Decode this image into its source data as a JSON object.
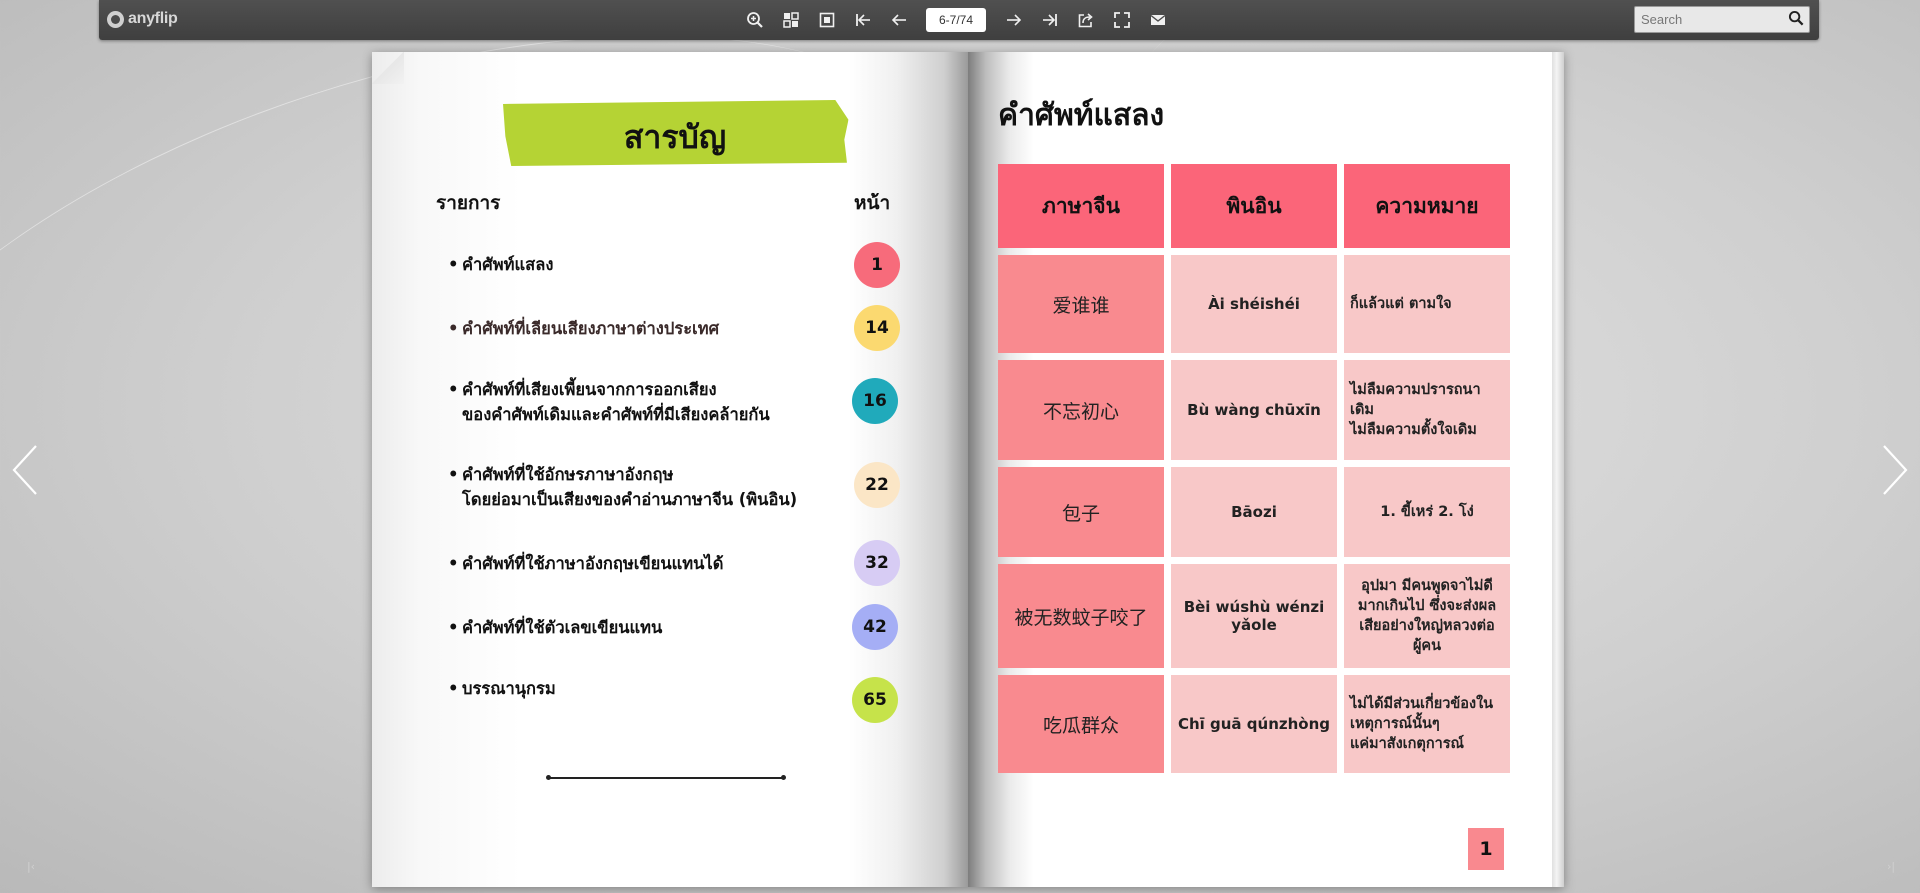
{
  "toolbar": {
    "logo_text": "anyflip",
    "page_indicator": "6-7/74",
    "search_placeholder": "Search",
    "icons": [
      "zoom-in-icon",
      "thumbnails-icon",
      "single-page-icon",
      "first-page-icon",
      "previous-page-icon",
      "next-page-icon",
      "last-page-icon",
      "share-icon",
      "fullscreen-icon",
      "email-icon",
      "search-icon"
    ]
  },
  "left_page": {
    "title": "สารบัญ",
    "header_items": "รายการ",
    "header_page": "หน้า",
    "highlight_color": "#b5d334",
    "items": [
      {
        "lines": [
          "คำศัพท์แสลง"
        ],
        "page": "1",
        "color": "#f76b7b"
      },
      {
        "lines": [
          "คำศัพท์ที่เลียนเสียงภาษาต่างประเทศ"
        ],
        "page": "14",
        "color": "#fbd970"
      },
      {
        "lines": [
          "คำศัพท์ที่เสียงเพี้ยนจากการออกเสียง",
          "ของคำศัพท์เดิมและคำศัพท์ที่มีเสียงคล้ายกัน"
        ],
        "page": "16",
        "color": "#20aabb"
      },
      {
        "lines": [
          "คำศัพท์ที่ใช้อักษรภาษาอังกฤษ",
          "โดยย่อมาเป็นเสียงของคำอ่านภาษาจีน (พินอิน)"
        ],
        "page": "22",
        "color": "#fbe6c6"
      },
      {
        "lines": [
          "คำศัพท์ที่ใช้ภาษาอังกฤษเขียนแทนได้"
        ],
        "page": "32",
        "color": "#d7ccf4"
      },
      {
        "lines": [
          "คำศัพท์ที่ใช้ตัวเลขเขียนแทน"
        ],
        "page": "42",
        "color": "#a5aef5"
      },
      {
        "lines": [
          "บรรณานุกรม"
        ],
        "page": "65",
        "color": "#c6e34a"
      }
    ]
  },
  "right_page": {
    "title": "คำศัพท์แสลง",
    "headers": [
      "ภาษาจีน",
      "พินอิน",
      "ความหมาย"
    ],
    "rows": [
      {
        "chinese": "爱谁谁",
        "pinyin": "Ài shéishéi",
        "meaning": "ก็แล้วแต่ ตามใจ"
      },
      {
        "chinese": "不忘初心",
        "pinyin": "Bù wàng chūxīn",
        "meaning": "ไม่ลืมความปรารถนา\nเดิม\nไม่ลืมความตั้งใจเดิม"
      },
      {
        "chinese": "包子",
        "pinyin": "Bāozi",
        "meaning": "1. ขี้เหร่ 2. โง่"
      },
      {
        "chinese": "被无数蚊子咬了",
        "pinyin": "Bèi wúshù wénzi yǎole",
        "meaning": "อุปมา มีคนพูดจาไม่ดี\nมากเกินไป ซึ่งจะส่งผล\nเสียอย่างใหญ่หลวงต่อ\nผู้คน"
      },
      {
        "chinese": "吃瓜群众",
        "pinyin": "Chī guā qúnzhòng",
        "meaning": "ไม่ได้มีส่วนเกี่ยวข้องใน\nเหตุการณ์นั้นๆ\nแค่มาสังเกตุการณ์"
      }
    ],
    "page_number": "1",
    "colors": {
      "header": "#fb6579",
      "chinese_cell": "#f98a8f",
      "light_cell": "#f8c8c8"
    }
  }
}
